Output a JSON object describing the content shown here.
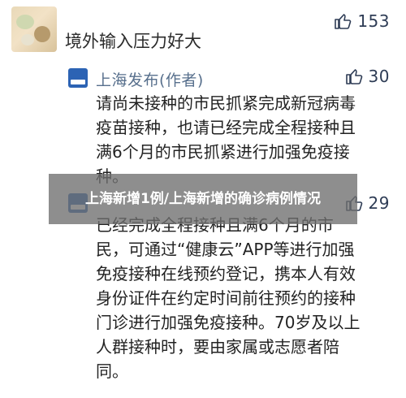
{
  "comment": {
    "text": "境外输入压力好大",
    "likes": "153"
  },
  "replies": [
    {
      "author": "上海发布(作者)",
      "likes": "30",
      "lines": [
        "请尚未接种的市民抓紧完成新冠病毒",
        "疫苗接种，也请已经完成全程接种且",
        "满6个月的市民抓紧进行加强免疫接",
        "种。"
      ]
    },
    {
      "author": "",
      "likes": "29",
      "lines": [
        "已经完成全程接种且满6个月的市",
        "民，可通过“健康云”APP等进行加强",
        "免疫接种在线预约登记，携本人有效",
        "身份证件在约定时间前往预约的接种",
        "门诊进行加强免疫接种。70岁及以上",
        "人群接种时，要由家属或志愿者陪",
        "同。"
      ]
    }
  ],
  "overlay": {
    "caption": "上海新增1例/上海新增的确诊病例情况"
  },
  "icons": {
    "like": "thumbs-up-icon",
    "logo": "shanghai-fabu-logo-icon"
  },
  "colors": {
    "like": "#2e3c55",
    "author": "#58708d",
    "logo": "#2c63b4"
  }
}
